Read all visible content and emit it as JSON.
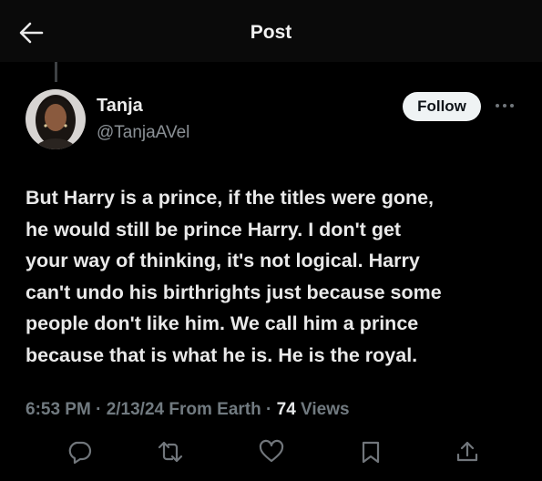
{
  "header": {
    "back_icon": "arrow-left-icon",
    "title": "Post"
  },
  "author": {
    "name": "Tanja",
    "handle": "@TanjaAVel",
    "follow_label": "Follow",
    "more_icon": "more-horizontal-icon"
  },
  "tweet": {
    "text": "But Harry is a prince, if the titles were gone,\nhe would still be prince Harry. I don't get\nyour way of thinking, it's not logical. Harry\ncan't undo his birthrights just because some\npeople don't like him. We call him a prince\nbecause that is what he is. He is the royal."
  },
  "meta": {
    "time": "6:53 PM",
    "sep1": " · ",
    "date": "2/13/24",
    "source": " From Earth",
    "sep2": " · ",
    "views_count": "74",
    "views_label": " Views"
  },
  "actions": [
    {
      "name": "reply",
      "icon": "reply-icon"
    },
    {
      "name": "repost",
      "icon": "repost-icon"
    },
    {
      "name": "like",
      "icon": "heart-icon"
    },
    {
      "name": "bookmark",
      "icon": "bookmark-icon"
    },
    {
      "name": "share",
      "icon": "share-icon"
    }
  ],
  "colors": {
    "background": "#000000",
    "header": "#0a0a0a",
    "text": "#e9e9e9",
    "secondary": "#717a80",
    "follow_bg": "#eff3f4",
    "icon": "#71767b"
  }
}
